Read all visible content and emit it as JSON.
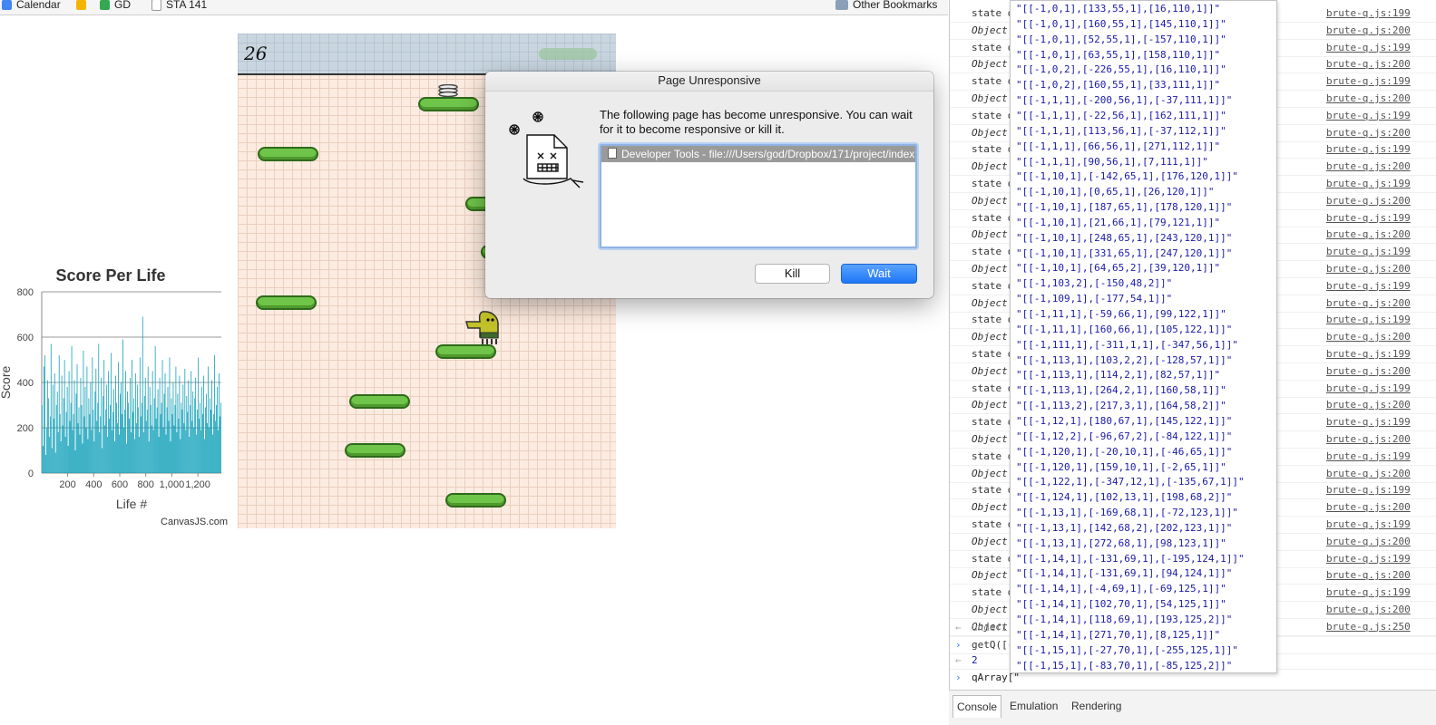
{
  "bookmarks": [
    {
      "label": "Calendar",
      "color": "#4285f4"
    },
    {
      "label": "",
      "color": "#f4b400"
    },
    {
      "label": "GD",
      "color": "#34a853"
    },
    {
      "label": "STA 141",
      "color": "#cccccc"
    },
    {
      "label": "Other Bookmarks",
      "color": "#8aa0b8"
    }
  ],
  "chart_data": {
    "type": "bar",
    "title": "Score Per Life",
    "xlabel": "Life #",
    "ylabel": "Score",
    "ylim": [
      0,
      800
    ],
    "yticks": [
      "0",
      "200",
      "400",
      "600",
      "800"
    ],
    "xticks": [
      "200",
      "400",
      "600",
      "800",
      "1,000",
      "1,200"
    ],
    "xrange": [
      1,
      1380
    ],
    "color": "#12a0b9",
    "values": [
      300,
      120,
      470,
      520,
      80,
      200,
      410,
      330,
      160,
      250,
      570,
      110,
      390,
      240,
      440,
      90,
      300,
      360,
      180,
      520,
      260,
      140,
      430,
      210,
      330,
      500,
      160,
      270,
      380,
      120,
      450,
      230,
      310,
      560,
      190,
      260,
      410,
      100,
      350,
      480,
      220,
      290,
      170,
      420,
      300,
      130,
      540,
      250,
      380,
      200,
      470,
      150,
      330,
      260,
      400,
      190,
      510,
      280,
      140,
      360,
      460,
      230,
      310,
      570,
      180,
      250,
      420,
      110,
      340,
      500,
      210,
      280,
      390,
      160,
      450,
      240,
      300,
      530,
      190,
      270,
      370,
      140,
      430,
      310,
      220,
      490,
      170,
      350,
      400,
      260,
      590,
      200,
      280,
      450,
      130,
      360,
      310,
      240,
      420,
      180,
      500,
      270,
      330,
      150,
      440,
      220,
      390,
      290,
      160,
      510,
      250,
      310,
      690,
      180,
      340,
      420,
      230,
      280,
      470,
      140,
      380,
      300,
      210,
      450,
      190,
      330,
      560,
      240,
      290,
      370,
      160,
      420,
      260,
      310,
      500,
      200,
      350,
      440,
      170,
      290,
      380,
      230,
      510,
      140,
      330,
      260,
      400,
      210,
      300,
      470,
      180,
      350,
      240,
      430,
      150,
      310,
      280,
      390,
      220,
      460,
      190,
      340,
      270,
      410,
      160,
      300,
      450,
      230,
      360,
      200,
      330,
      420,
      170,
      280,
      510,
      240,
      310,
      190,
      380,
      260,
      430,
      150,
      290,
      350,
      220,
      470,
      200,
      330,
      280,
      410,
      170,
      260,
      520,
      230,
      300,
      380,
      190,
      440,
      250,
      310
    ]
  },
  "game": {
    "score": "26"
  },
  "modal": {
    "title": "Page Unresponsive",
    "message": "The following page has become unresponsive. You can wait for it to become responsive or kill it.",
    "page_entry": "Developer Tools - file:///Users/god/Dropbox/171/project/index",
    "kill_label": "Kill",
    "wait_label": "Wait"
  },
  "console": {
    "lines": [
      {
        "text": "state o",
        "link": "brute-q.js:199"
      },
      {
        "text": "Object",
        "link": "brute-q.js:200"
      },
      {
        "text": "state o",
        "link": "brute-q.js:199"
      },
      {
        "text": "Object",
        "link": "brute-q.js:200"
      },
      {
        "text": "state o",
        "link": "brute-q.js:199"
      },
      {
        "text": "Object",
        "link": "brute-q.js:200"
      },
      {
        "text": "state o",
        "link": "brute-q.js:199"
      },
      {
        "text": "Object",
        "link": "brute-q.js:200"
      },
      {
        "text": "state o",
        "link": "brute-q.js:199"
      },
      {
        "text": "Object",
        "link": "brute-q.js:200"
      },
      {
        "text": "state o",
        "link": "brute-q.js:199"
      },
      {
        "text": "Object",
        "link": "brute-q.js:200"
      },
      {
        "text": "state o",
        "link": "brute-q.js:199"
      },
      {
        "text": "Object",
        "link": "brute-q.js:200"
      },
      {
        "text": "state o",
        "link": "brute-q.js:199"
      },
      {
        "text": "Object",
        "link": "brute-q.js:200"
      },
      {
        "text": "state o",
        "link": "brute-q.js:199"
      },
      {
        "text": "Object",
        "link": "brute-q.js:200"
      },
      {
        "text": "state o",
        "link": "brute-q.js:199"
      },
      {
        "text": "Object",
        "link": "brute-q.js:200"
      },
      {
        "text": "state o",
        "link": "brute-q.js:199"
      },
      {
        "text": "Object",
        "link": "brute-q.js:200"
      },
      {
        "text": "state o",
        "link": "brute-q.js:199"
      },
      {
        "text": "Object",
        "link": "brute-q.js:200"
      },
      {
        "text": "state o",
        "link": "brute-q.js:199"
      },
      {
        "text": "Object",
        "link": "brute-q.js:200"
      },
      {
        "text": "state o",
        "link": "brute-q.js:199"
      },
      {
        "text": "Object",
        "link": "brute-q.js:200"
      },
      {
        "text": "state o",
        "link": "brute-q.js:199"
      },
      {
        "text": "Object",
        "link": "brute-q.js:200"
      },
      {
        "text": "state o",
        "link": "brute-q.js:199"
      },
      {
        "text": "Object",
        "link": "brute-q.js:200"
      },
      {
        "text": "state o",
        "link": "brute-q.js:199"
      },
      {
        "text": "Object",
        "link": "brute-q.js:200"
      },
      {
        "text": "state o",
        "link": "brute-q.js:199"
      },
      {
        "text": "Object",
        "link": "brute-q.js:200"
      },
      {
        "text": "Object",
        "link": "brute-q.js:250"
      }
    ],
    "undef": "undefi",
    "cmd1": "getQ([-",
    "result": "2",
    "input": "qArray[\""
  },
  "autocomplete": [
    "\"[[-1,0,1],[133,55,1],[16,110,1]]\"",
    "\"[[-1,0,1],[160,55,1],[145,110,1]]\"",
    "\"[[-1,0,1],[52,55,1],[-157,110,1]]\"",
    "\"[[-1,0,1],[63,55,1],[158,110,1]]\"",
    "\"[[-1,0,2],[-226,55,1],[16,110,1]]\"",
    "\"[[-1,0,2],[160,55,1],[33,111,1]]\"",
    "\"[[-1,1,1],[-200,56,1],[-37,111,1]]\"",
    "\"[[-1,1,1],[-22,56,1],[162,111,1]]\"",
    "\"[[-1,1,1],[113,56,1],[-37,112,1]]\"",
    "\"[[-1,1,1],[66,56,1],[271,112,1]]\"",
    "\"[[-1,1,1],[90,56,1],[7,111,1]]\"",
    "\"[[-1,10,1],[-142,65,1],[176,120,1]]\"",
    "\"[[-1,10,1],[0,65,1],[26,120,1]]\"",
    "\"[[-1,10,1],[187,65,1],[178,120,1]]\"",
    "\"[[-1,10,1],[21,66,1],[79,121,1]]\"",
    "\"[[-1,10,1],[248,65,1],[243,120,1]]\"",
    "\"[[-1,10,1],[331,65,1],[247,120,1]]\"",
    "\"[[-1,10,1],[64,65,2],[39,120,1]]\"",
    "\"[[-1,103,2],[-150,48,2]]\"",
    "\"[[-1,109,1],[-177,54,1]]\"",
    "\"[[-1,11,1],[-59,66,1],[99,122,1]]\"",
    "\"[[-1,11,1],[160,66,1],[105,122,1]]\"",
    "\"[[-1,111,1],[-311,1,1],[-347,56,1]]\"",
    "\"[[-1,113,1],[103,2,2],[-128,57,1]]\"",
    "\"[[-1,113,1],[114,2,1],[82,57,1]]\"",
    "\"[[-1,113,1],[264,2,1],[160,58,1]]\"",
    "\"[[-1,113,2],[217,3,1],[164,58,2]]\"",
    "\"[[-1,12,1],[180,67,1],[145,122,1]]\"",
    "\"[[-1,12,2],[-96,67,2],[-84,122,1]]\"",
    "\"[[-1,120,1],[-20,10,1],[-46,65,1]]\"",
    "\"[[-1,120,1],[159,10,1],[-2,65,1]]\"",
    "\"[[-1,122,1],[-347,12,1],[-135,67,1]]\"",
    "\"[[-1,124,1],[102,13,1],[198,68,2]]\"",
    "\"[[-1,13,1],[-169,68,1],[-72,123,1]]\"",
    "\"[[-1,13,1],[142,68,2],[202,123,1]]\"",
    "\"[[-1,13,1],[272,68,1],[98,123,1]]\"",
    "\"[[-1,14,1],[-131,69,1],[-195,124,1]]\"",
    "\"[[-1,14,1],[-131,69,1],[94,124,1]]\"",
    "\"[[-1,14,1],[-4,69,1],[-69,125,1]]\"",
    "\"[[-1,14,1],[102,70,1],[54,125,1]]\"",
    "\"[[-1,14,1],[118,69,1],[193,125,2]]\"",
    "\"[[-1,14,1],[271,70,1],[8,125,1]]\"",
    "\"[[-1,15,1],[-27,70,1],[-255,125,1]]\"",
    "\"[[-1,15,1],[-83,70,1],[-85,125,2]]\""
  ],
  "devtools_tabs": [
    "Console",
    "Emulation",
    "Rendering"
  ],
  "canvasjs_credit": "CanvasJS.com"
}
